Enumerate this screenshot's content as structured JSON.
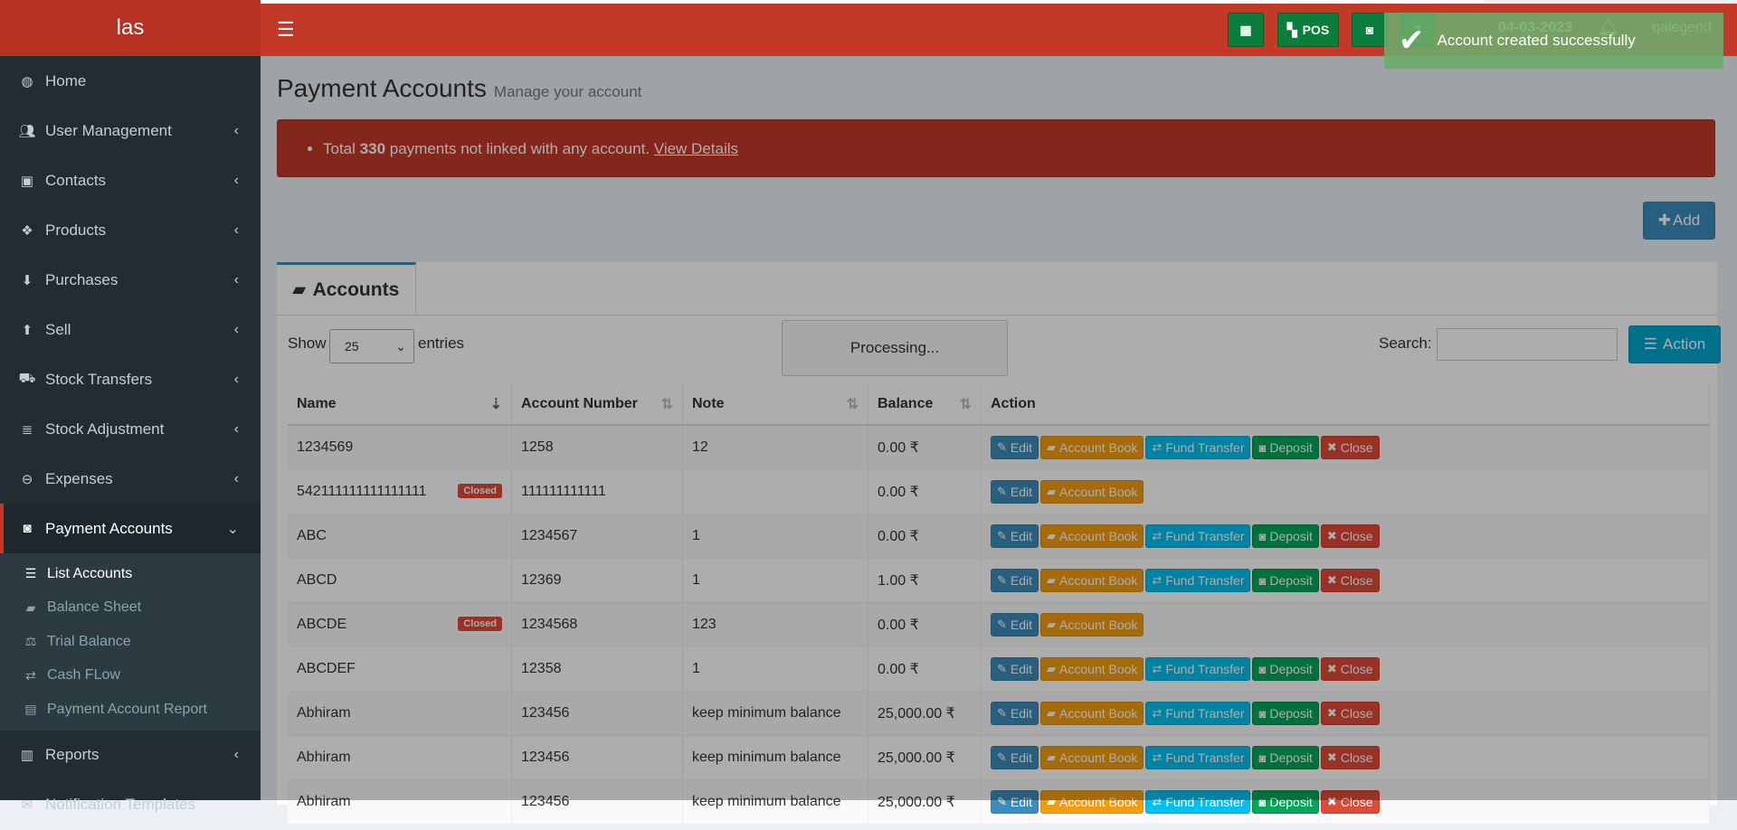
{
  "brand": "las",
  "navbar": {
    "toggle_icon": "bars-icon",
    "pos_label": "POS",
    "date": "04-03-2023",
    "user": "qalegend"
  },
  "toast": {
    "message": "Account created successfully"
  },
  "sidebar": {
    "items": [
      {
        "label": "Home",
        "icon": "dashboard-icon",
        "chevron": false
      },
      {
        "label": "User Management",
        "icon": "users-icon",
        "chevron": true
      },
      {
        "label": "Contacts",
        "icon": "address-book-icon",
        "chevron": true
      },
      {
        "label": "Products",
        "icon": "cubes-icon",
        "chevron": true
      },
      {
        "label": "Purchases",
        "icon": "arrow-circle-down-icon",
        "chevron": true
      },
      {
        "label": "Sell",
        "icon": "arrow-circle-up-icon",
        "chevron": true
      },
      {
        "label": "Stock Transfers",
        "icon": "truck-icon",
        "chevron": true
      },
      {
        "label": "Stock Adjustment",
        "icon": "database-icon",
        "chevron": true
      },
      {
        "label": "Expenses",
        "icon": "minus-circle-icon",
        "chevron": true
      },
      {
        "label": "Payment Accounts",
        "icon": "money-icon",
        "chevron": true,
        "active": true
      }
    ],
    "sub_items": [
      {
        "label": "List Accounts",
        "icon": "list-icon",
        "active": true
      },
      {
        "label": "Balance Sheet",
        "icon": "book-icon"
      },
      {
        "label": "Trial Balance",
        "icon": "balance-scale-icon"
      },
      {
        "label": "Cash FLow",
        "icon": "exchange-icon"
      },
      {
        "label": "Payment Account Report",
        "icon": "file-text-icon"
      }
    ],
    "after_items": [
      {
        "label": "Reports",
        "icon": "bar-chart-icon",
        "chevron": true
      },
      {
        "label": "Notification Templates",
        "icon": "envelope-icon",
        "chevron": false
      }
    ]
  },
  "page": {
    "title": "Payment Accounts",
    "subtitle": "Manage your account"
  },
  "alert": {
    "prefix": "Total",
    "count": "330",
    "suffix": "payments not linked with any account.",
    "link": "View Details"
  },
  "add_button": "Add",
  "tab_label": "Accounts",
  "table_controls": {
    "show": "Show",
    "page_size": "25",
    "entries": "entries",
    "processing": "Processing...",
    "search_label": "Search:",
    "search_value": "",
    "action_button": "Action"
  },
  "columns": [
    "Name",
    "Account Number",
    "Note",
    "Balance",
    "Action"
  ],
  "row_actions": {
    "edit": "Edit",
    "book": "Account Book",
    "fund": "Fund Transfer",
    "deposit": "Deposit",
    "close": "Close"
  },
  "closed_badge": "Closed",
  "rows": [
    {
      "name": "1234569",
      "number": "1258",
      "note": "12",
      "balance": "0.00 ₹",
      "closed": false
    },
    {
      "name": "542111111111111111",
      "number": "111111111111",
      "note": "",
      "balance": "0.00 ₹",
      "closed": true
    },
    {
      "name": "ABC",
      "number": "1234567",
      "note": "1",
      "balance": "0.00 ₹",
      "closed": false
    },
    {
      "name": "ABCD",
      "number": "12369",
      "note": "1",
      "balance": "1.00 ₹",
      "closed": false
    },
    {
      "name": "ABCDE",
      "number": "1234568",
      "note": "123",
      "balance": "0.00 ₹",
      "closed": true
    },
    {
      "name": "ABCDEF",
      "number": "12358",
      "note": "1",
      "balance": "0.00 ₹",
      "closed": false
    },
    {
      "name": "Abhiram",
      "number": "123456",
      "note": "keep minimum balance",
      "balance": "25,000.00 ₹",
      "closed": false
    },
    {
      "name": "Abhiram",
      "number": "123456",
      "note": "keep minimum balance",
      "balance": "25,000.00 ₹",
      "closed": false
    },
    {
      "name": "Abhiram",
      "number": "123456",
      "note": "keep minimum balance",
      "balance": "25,000.00 ₹",
      "closed": false
    }
  ],
  "colors": {
    "header_red": "#c43828",
    "brand_red": "#b73123",
    "sidebar_dark": "#222d32",
    "accent_blue": "#3c8dbc"
  }
}
